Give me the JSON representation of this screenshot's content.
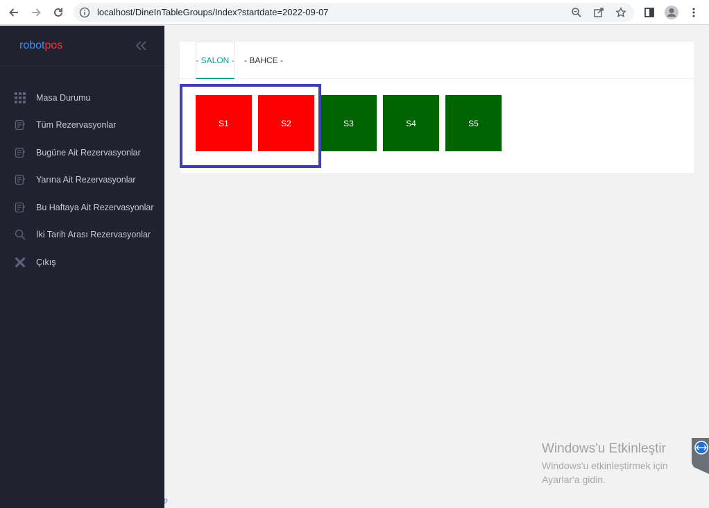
{
  "browser": {
    "url": "localhost/DineInTableGroups/Index?startdate=2022-09-07",
    "icons": [
      "back-arrow-icon",
      "forward-arrow-icon",
      "reload-icon",
      "info-icon",
      "zoom-icon",
      "share-icon",
      "star-icon",
      "side-panel-icon",
      "profile-icon",
      "kebab-menu-icon"
    ]
  },
  "sidebar": {
    "logo": {
      "part1": "robot",
      "part2": "pos"
    },
    "items": [
      {
        "label": "Masa Durumu",
        "icon": "grid-icon"
      },
      {
        "label": "Tüm Rezervasyonlar",
        "icon": "notes-icon"
      },
      {
        "label": "Bugüne Ait Rezervasyonlar",
        "icon": "notes-icon"
      },
      {
        "label": "Yarına Ait Rezervasyonlar",
        "icon": "notes-icon"
      },
      {
        "label": "Bu Haftaya Ait Rezervasyonlar",
        "icon": "notes-icon"
      },
      {
        "label": "İki Tarih Arası Rezervasyonlar",
        "icon": "search-icon"
      },
      {
        "label": "Çıkış",
        "icon": "close-x-icon"
      }
    ]
  },
  "main": {
    "tabs": [
      {
        "label": "- SALON -",
        "active": true
      },
      {
        "label": "- BAHCE -",
        "active": false
      }
    ],
    "tables": [
      {
        "label": "S1",
        "status": "occupied",
        "color": "#ff0000"
      },
      {
        "label": "S2",
        "status": "occupied",
        "color": "#ff0000"
      },
      {
        "label": "S3",
        "status": "free",
        "color": "#006400"
      },
      {
        "label": "S4",
        "status": "free",
        "color": "#006400"
      },
      {
        "label": "S5",
        "status": "free",
        "color": "#006400"
      }
    ]
  },
  "watermark": {
    "title": "Windows'u Etkinleştir",
    "line1": "Windows'u etkinleştirmek için",
    "line2": "Ayarlar'a gidin."
  },
  "footer_glyph": "p",
  "colors": {
    "accent": "#14a08a",
    "sidebar_bg": "#21212f",
    "occupied": "#ff0000",
    "free": "#006400",
    "highlight": "#3f3fae"
  }
}
